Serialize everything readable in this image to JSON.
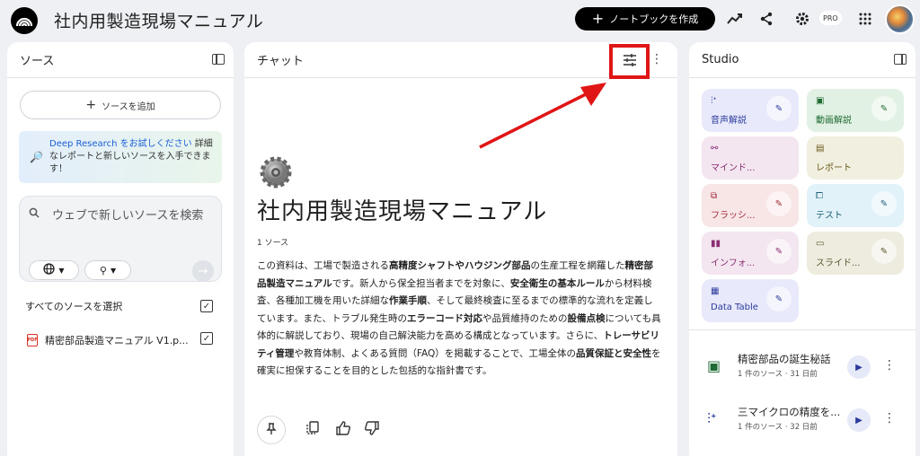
{
  "app": {
    "title": "社内用製造現場マニュアル",
    "create_label": "ノートブックを作成",
    "pro_badge": "PRO"
  },
  "sources": {
    "header": "ソース",
    "add_label": "ソースを追加",
    "dr_link": "Deep Research",
    "dr_link2": "をお試しください",
    "dr_text": "詳細なレポートと新しいソースを入手できます！",
    "search_placeholder": "ウェブで新しいソースを検索",
    "select_all": "すべてのソースを選択",
    "file_name": "精密部品製造マニュアル V1.p...",
    "pdf_label": "PDF"
  },
  "chat": {
    "header": "チャット",
    "title": "社内用製造現場マニュアル",
    "source_count": "1 ソース",
    "summary": [
      {
        "t": "この資料は、工場で製造される",
        "b": false
      },
      {
        "t": "高精度シャフトやハウジング部品",
        "b": true
      },
      {
        "t": "の生産工程を網羅した",
        "b": false
      },
      {
        "t": "精密部品製造マニュアル",
        "b": true
      },
      {
        "t": "です。新人から保全担当者までを対象に、",
        "b": false
      },
      {
        "t": "安全衛生の基本ルール",
        "b": true
      },
      {
        "t": "から材料検査、各種加工機を用いた詳細な",
        "b": false
      },
      {
        "t": "作業手順",
        "b": true
      },
      {
        "t": "、そして最終検査に至るまでの標準的な流れを定義しています。また、トラブル発生時の",
        "b": false
      },
      {
        "t": "エラーコード対応",
        "b": true
      },
      {
        "t": "や品質維持のための",
        "b": false
      },
      {
        "t": "設備点検",
        "b": true
      },
      {
        "t": "についても具体的に解説しており、現場の自己解決能力を高める構成となっています。さらに、",
        "b": false
      },
      {
        "t": "トレーサビリティ管理",
        "b": true
      },
      {
        "t": "や教育体制、よくある質問（FAQ）を掲載することで、工場全体の",
        "b": false
      },
      {
        "t": "品質保証と安全性",
        "b": true
      },
      {
        "t": "を確実に担保することを目的とした包括的な指針書です。",
        "b": false
      }
    ]
  },
  "studio": {
    "header": "Studio",
    "tiles": [
      {
        "label": "音声解説"
      },
      {
        "label": "動画解説"
      },
      {
        "label": "マインド..."
      },
      {
        "label": "レポート"
      },
      {
        "label": "フラッシ..."
      },
      {
        "label": "テスト"
      },
      {
        "label": "インフォ..."
      },
      {
        "label": "スライド..."
      },
      {
        "label": "Data Table"
      }
    ],
    "notes": [
      {
        "title": "精密部品の誕生秘話",
        "sub": "1 件のソース · 31 日前"
      },
      {
        "title": "三マイクロの精度を...",
        "sub": "1 件のソース · 32 日前"
      }
    ]
  },
  "colors": {
    "highlight": "#e01515",
    "accent": "#1a5fd6"
  }
}
